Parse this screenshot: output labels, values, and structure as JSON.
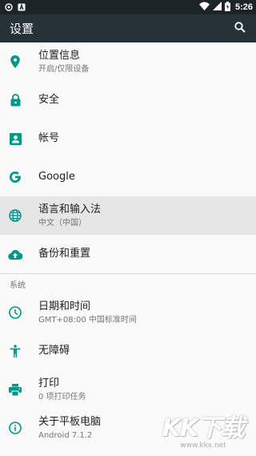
{
  "status_bar": {
    "time": "5:26",
    "icons": [
      "notification-icon",
      "notification-a-icon",
      "wifi-icon",
      "signal-icon",
      "battery-icon"
    ]
  },
  "app_bar": {
    "title": "设置",
    "search_icon": "search-icon"
  },
  "items": [
    {
      "title": "位置信息",
      "subtitle": "开启/仅限设备",
      "icon": "location-icon"
    },
    {
      "title": "安全",
      "subtitle": "",
      "icon": "lock-icon"
    },
    {
      "title": "帐号",
      "subtitle": "",
      "icon": "account-icon"
    },
    {
      "title": "Google",
      "subtitle": "",
      "icon": "google-icon"
    },
    {
      "title": "语言和输入法",
      "subtitle": "中文（中国）",
      "icon": "globe-icon"
    },
    {
      "title": "备份和重置",
      "subtitle": "",
      "icon": "cloud-upload-icon"
    }
  ],
  "system_section": {
    "header": "系统",
    "items": [
      {
        "title": "日期和时间",
        "subtitle": "GMT+08:00 中国标准时间",
        "icon": "clock-icon"
      },
      {
        "title": "无障碍",
        "subtitle": "",
        "icon": "accessibility-icon"
      },
      {
        "title": "打印",
        "subtitle": "0 项打印任务",
        "icon": "print-icon"
      },
      {
        "title": "关于平板电脑",
        "subtitle": "Android 7.1.2",
        "icon": "info-icon"
      }
    ]
  },
  "colors": {
    "accent": "#009688",
    "app_bar": "#263238",
    "status_bar": "#1d2428",
    "highlight": "#e6e6e6"
  },
  "watermark": {
    "logo": "KK下载",
    "url": "www.kkx.net"
  }
}
